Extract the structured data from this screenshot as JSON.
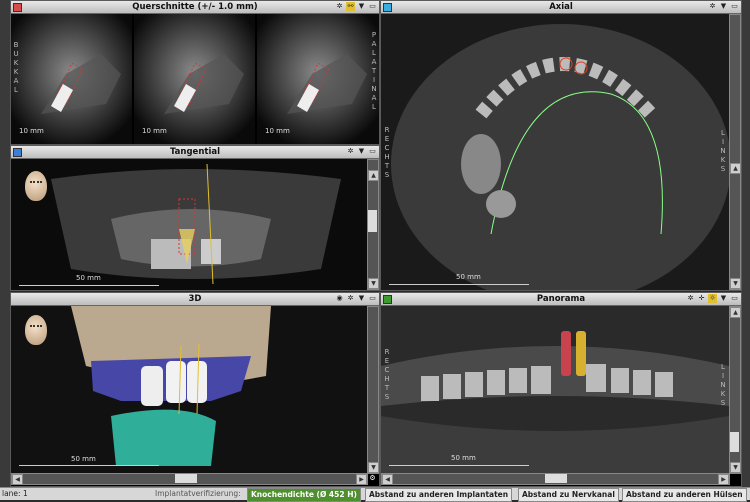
{
  "panes": {
    "querschnitte": {
      "title": "Querschnitte (+/- 1.0 mm)",
      "scale": [
        "10 mm",
        "10 mm",
        "10 mm"
      ],
      "left_label": "BUKKAL",
      "right_label": "PALATINAL",
      "box_color": "#d94c4c"
    },
    "tangential": {
      "title": "Tangential",
      "scale": "50 mm",
      "box_color": "#3a7fd5"
    },
    "axial": {
      "title": "Axial",
      "scale": "50 mm",
      "left_label": "RECHTS",
      "right_label": "LINKS",
      "box_color": "#3aaee0"
    },
    "view3d": {
      "title": "3D",
      "scale": "50 mm",
      "box_color": "#d94c4c"
    },
    "panorama": {
      "title": "Panorama",
      "scale": "50 mm",
      "left_label": "RECHTS",
      "right_label": "LINKS",
      "box_color": "#3d9a2e"
    }
  },
  "statusbar": {
    "plane": "lane: 1",
    "label": "Implantatverifizierung:",
    "buttons": [
      "Knochendichte (Ø 452 H)",
      "Abstand zu anderen Implantaten",
      "Abstand zu Nervkanal",
      "Abstand zu anderen Hülsen"
    ]
  },
  "icons": [
    "settings-icon",
    "dropdown-icon",
    "maximize-icon",
    "eye-icon",
    "crosshair-icon"
  ]
}
